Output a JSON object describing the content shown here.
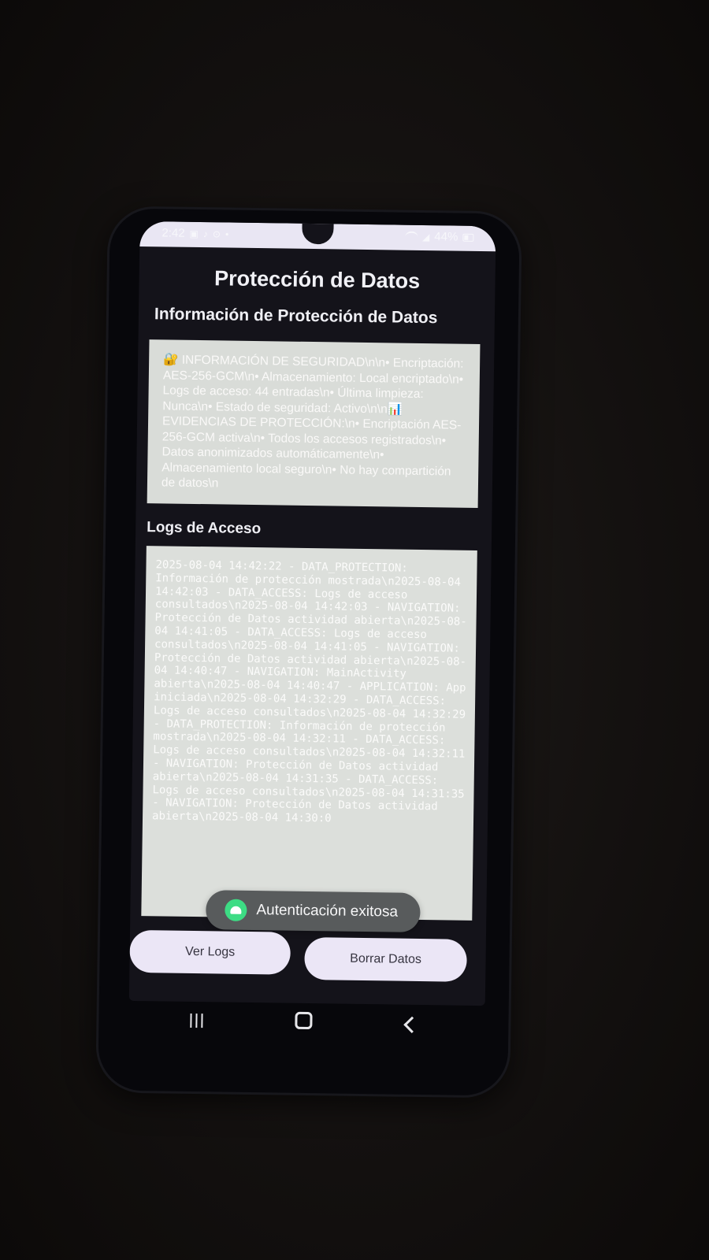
{
  "status_bar": {
    "time": "2:42",
    "battery": "44%"
  },
  "app": {
    "title": "Protección de Datos"
  },
  "info_section": {
    "title": "Información de Protección de Datos",
    "text": "🔐 INFORMACIÓN DE SEGURIDAD\\n\\n• Encriptación: AES-256-GCM\\n• Almacenamiento: Local encriptado\\n• Logs de acceso: 44 entradas\\n• Última limpieza: Nunca\\n• Estado de seguridad: Activo\\n\\n📊 EVIDENCIAS DE PROTECCIÓN:\\n• Encriptación AES-256-GCM activa\\n• Todos los accesos registrados\\n• Datos anonimizados automáticamente\\n• Almacenamiento local seguro\\n• No hay compartición de datos\\n"
  },
  "logs_section": {
    "title": "Logs de Acceso",
    "text": "2025-08-04 14:42:22 - DATA_PROTECTION: Información de protección mostrada\\n2025-08-04 14:42:03 - DATA_ACCESS: Logs de acceso consultados\\n2025-08-04 14:42:03 - NAVIGATION: Protección de Datos actividad abierta\\n2025-08-04 14:41:05 - DATA_ACCESS: Logs de acceso consultados\\n2025-08-04 14:41:05 - NAVIGATION: Protección de Datos actividad abierta\\n2025-08-04 14:40:47 - NAVIGATION: MainActivity abierta\\n2025-08-04 14:40:47 - APPLICATION: App iniciada\\n2025-08-04 14:32:29 - DATA_ACCESS: Logs de acceso consultados\\n2025-08-04 14:32:29 - DATA_PROTECTION: Información de protección mostrada\\n2025-08-04 14:32:11 - DATA_ACCESS: Logs de acceso consultados\\n2025-08-04 14:32:11 - NAVIGATION: Protección de Datos actividad abierta\\n2025-08-04 14:31:35 - DATA_ACCESS: Logs de acceso consultados\\n2025-08-04 14:31:35 - NAVIGATION: Protección de Datos actividad abierta\\n2025-08-04 14:30:0"
  },
  "toast": {
    "message": "Autenticación exitosa",
    "icon": "android-robot-icon"
  },
  "buttons": {
    "view_logs": "Ver Logs",
    "clear_data": "Borrar Datos"
  },
  "nav_bar": {
    "recent_icon": "recent-apps-icon",
    "home_icon": "home-icon",
    "back_icon": "back-icon"
  },
  "colors": {
    "screen_bg": "#14131a",
    "text_box_bg": "#d9dcd8",
    "button_bg": "#ebe6f6",
    "toast_bg": "#585b5c",
    "android_green": "#3ddc84"
  }
}
